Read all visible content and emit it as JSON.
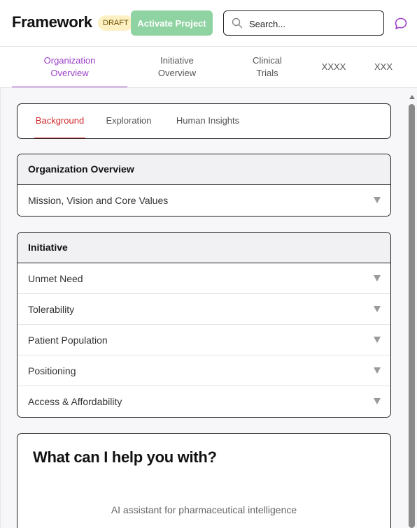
{
  "header": {
    "brand": "Framework",
    "status_badge": "DRAFT",
    "activate_label": "Activate Project",
    "search_placeholder": "Search..."
  },
  "top_tabs": [
    {
      "line1": "Organization",
      "line2": "Overview",
      "active": true
    },
    {
      "line1": "Initiative",
      "line2": "Overview",
      "active": false
    },
    {
      "line1": "Clinical",
      "line2": "Trials",
      "active": false
    },
    {
      "line1": "XXXX",
      "line2": "",
      "active": false
    },
    {
      "line1": "XXX",
      "line2": "",
      "active": false
    }
  ],
  "sub_tabs": [
    {
      "label": "Background",
      "active": true
    },
    {
      "label": "Exploration",
      "active": false
    },
    {
      "label": "Human Insights",
      "active": false
    }
  ],
  "organization_section": {
    "title": "Organization Overview",
    "items": [
      "Mission, Vision and Core Values"
    ]
  },
  "initiative_section": {
    "title": "Initiative",
    "items": [
      "Unmet Need",
      "Tolerability",
      "Patient Population",
      "Positioning",
      "Access & Affordability"
    ]
  },
  "assistant": {
    "title": "What can I help you with?",
    "subtitle": "AI assistant for pharmaceutical intelligence"
  },
  "colors": {
    "accent_purple": "#9b3fc7",
    "accent_red": "#d02a2a",
    "activate_green": "#8fd3a2",
    "draft_yellow": "#fdf1c4"
  },
  "icons": [
    "search-icon",
    "chat-bubble-icon",
    "chevron-down-icon"
  ]
}
